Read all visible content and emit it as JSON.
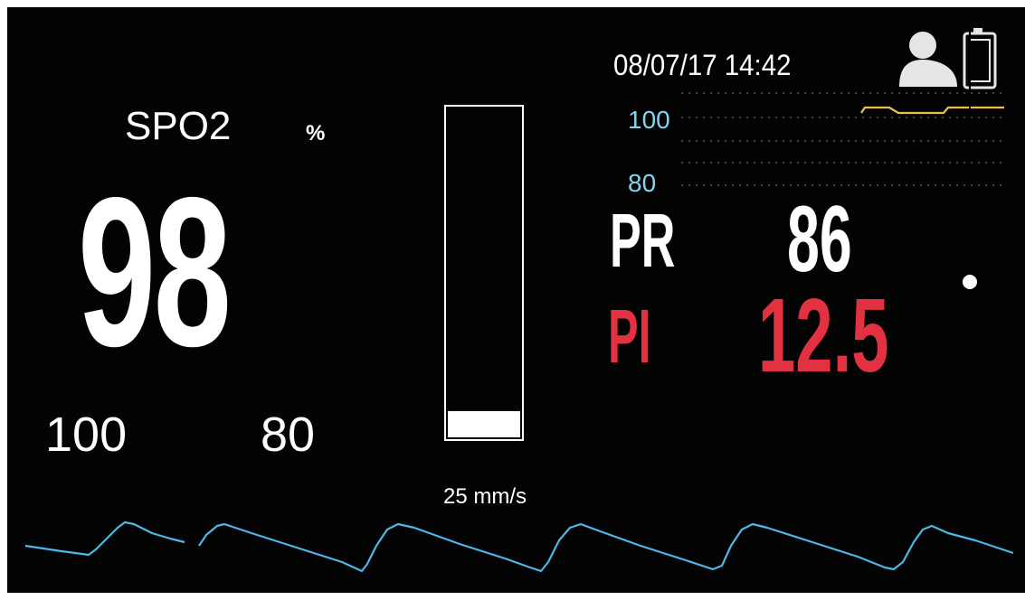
{
  "device": {
    "datetime": "08/07/17 14:42"
  },
  "spo2": {
    "label": "SPO2",
    "unit": "%",
    "value": "98",
    "alarm_high": "100",
    "alarm_low": "80"
  },
  "signal_bar": {
    "level_fraction": 0.08
  },
  "waveform": {
    "sweep_speed": "25 mm/s",
    "color": "#4fb7e6"
  },
  "trend": {
    "scale_high": "100",
    "scale_low": "80",
    "trace_color": "#e9c04f"
  },
  "pulse_rate": {
    "label": "PR",
    "value": "86"
  },
  "perfusion_index": {
    "label": "PI",
    "value": "12.5",
    "color": "#e23140"
  },
  "icons": [
    "patient-icon",
    "battery-icon"
  ]
}
